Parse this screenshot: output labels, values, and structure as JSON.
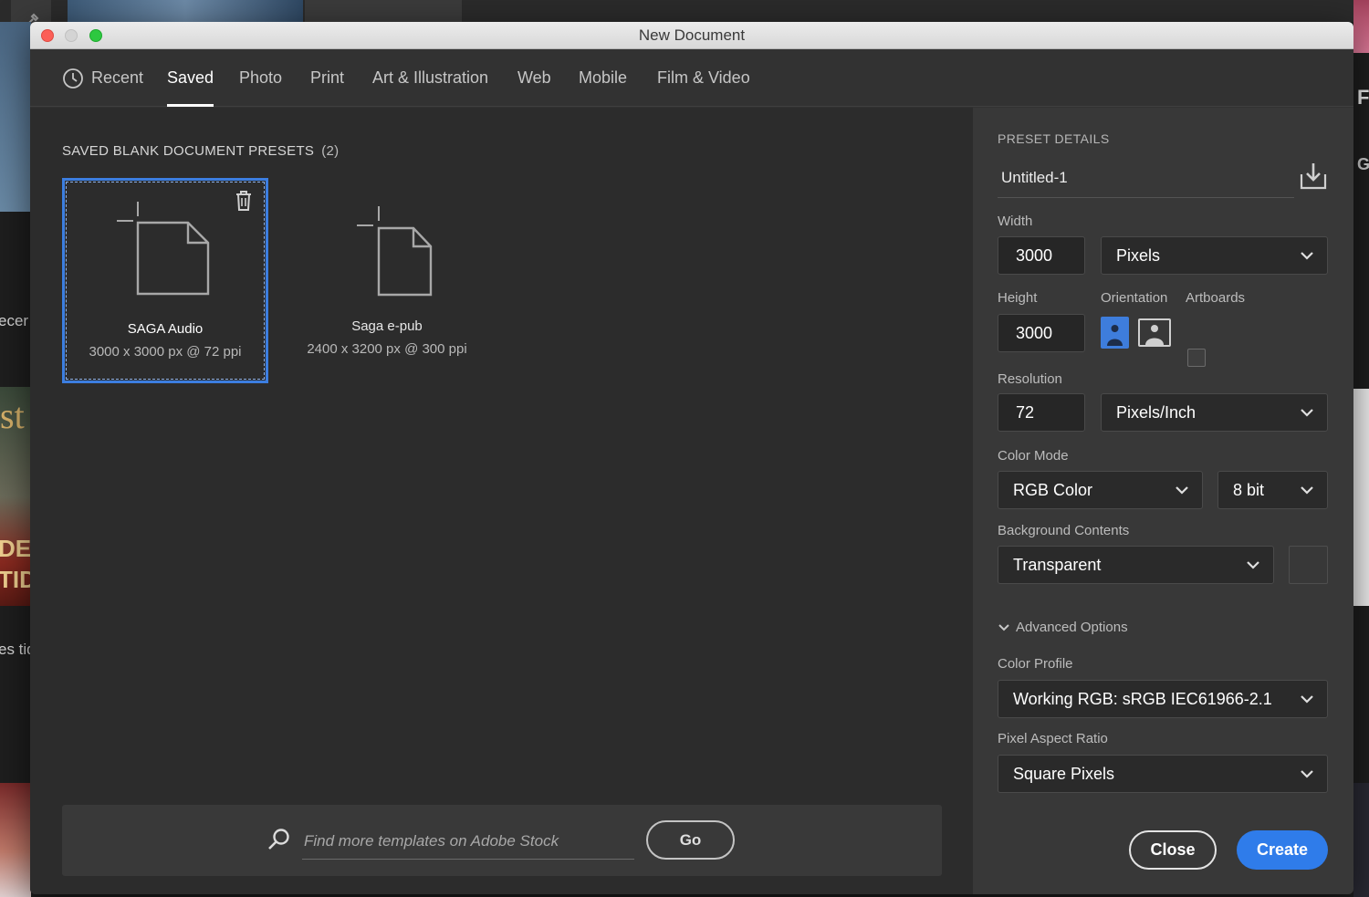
{
  "background": {
    "left_text_1": "ecer",
    "left_text_2": "es tid",
    "right_letter_1": "F",
    "right_letter_2": "G",
    "magazine_text_1": "st",
    "magazine_text_2": "DEL",
    "magazine_text_3": "TID"
  },
  "window": {
    "title": "New Document"
  },
  "tabs": [
    {
      "label": "Recent",
      "icon": "clock-icon"
    },
    {
      "label": "Saved",
      "active": true
    },
    {
      "label": "Photo"
    },
    {
      "label": "Print"
    },
    {
      "label": "Art & Illustration"
    },
    {
      "label": "Web"
    },
    {
      "label": "Mobile"
    },
    {
      "label": "Film & Video"
    }
  ],
  "presets_section": {
    "heading": "SAVED BLANK DOCUMENT PRESETS",
    "count": "(2)"
  },
  "presets": [
    {
      "name": "SAGA Audio",
      "dims": "3000 x 3000 px @ 72 ppi",
      "selected": true
    },
    {
      "name": "Saga e-pub",
      "dims": "2400 x 3200 px @ 300 ppi",
      "selected": false
    }
  ],
  "stock": {
    "placeholder": "Find more templates on Adobe Stock",
    "go_label": "Go"
  },
  "details": {
    "heading": "PRESET DETAILS",
    "name": "Untitled-1",
    "width_label": "Width",
    "width_value": "3000",
    "width_unit": "Pixels",
    "height_label": "Height",
    "height_value": "3000",
    "orientation_label": "Orientation",
    "artboards_label": "Artboards",
    "resolution_label": "Resolution",
    "resolution_value": "72",
    "resolution_unit": "Pixels/Inch",
    "color_mode_label": "Color Mode",
    "color_mode": "RGB Color",
    "bit_depth": "8 bit",
    "background_label": "Background Contents",
    "background": "Transparent",
    "advanced_label": "Advanced Options",
    "color_profile_label": "Color Profile",
    "color_profile": "Working RGB: sRGB IEC61966-2.1",
    "pixel_aspect_label": "Pixel Aspect Ratio",
    "pixel_aspect": "Square Pixels",
    "close_label": "Close",
    "create_label": "Create"
  },
  "colors": {
    "accent": "#2f7cea",
    "selection": "#3c7ee0",
    "panel": "#383838",
    "content": "#2c2c2c"
  }
}
